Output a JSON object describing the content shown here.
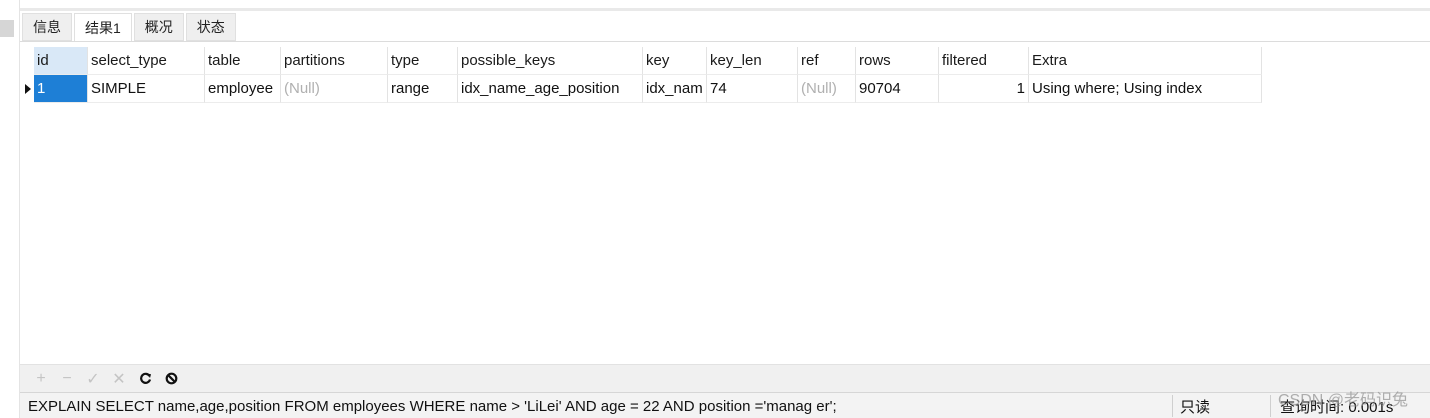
{
  "tabs": [
    "信息",
    "结果1",
    "概况",
    "状态"
  ],
  "active_tab": 1,
  "columns": [
    "id",
    "select_type",
    "table",
    "partitions",
    "type",
    "possible_keys",
    "key",
    "key_len",
    "ref",
    "rows",
    "filtered",
    "Extra"
  ],
  "rows": [
    {
      "id": "1",
      "select_type": "SIMPLE",
      "table": "employee",
      "partitions": "(Null)",
      "type": "range",
      "possible_keys": "idx_name_age_position",
      "key": "idx_nam",
      "key_len": "74",
      "ref": "(Null)",
      "rows": "90704",
      "filtered": "1",
      "Extra": "Using where; Using index"
    }
  ],
  "toolbar": {
    "icons": [
      "plus-icon",
      "minus-icon",
      "check-icon",
      "cross-icon",
      "refresh-icon",
      "stop-icon"
    ]
  },
  "status": {
    "sql": "EXPLAIN SELECT name,age,position FROM employees WHERE name > 'LiLei' AND age = 22 AND position ='manag er';",
    "readonly": "只读",
    "query_time": "查询时间: 0.001s"
  },
  "watermark": "CSDN @老码识兔"
}
